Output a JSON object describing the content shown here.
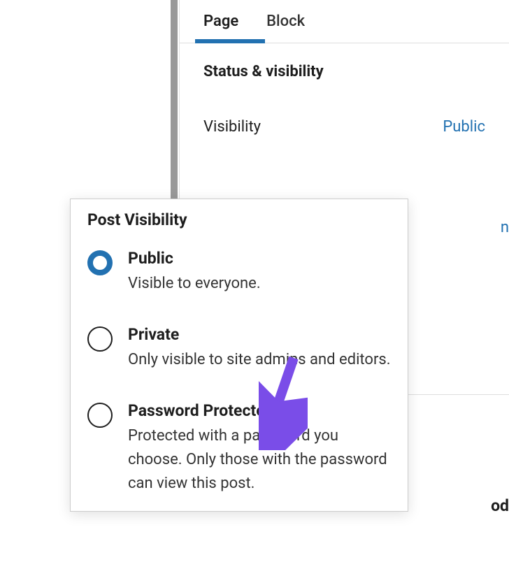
{
  "tabs": {
    "page": "Page",
    "block": "Block"
  },
  "panel": {
    "section_title": "Status & visibility",
    "visibility_label": "Visibility",
    "visibility_value": "Public"
  },
  "partial": {
    "link_fragment": "n",
    "text_fragment": "od"
  },
  "popover": {
    "title": "Post Visibility",
    "options": [
      {
        "label": "Public",
        "desc": "Visible to everyone.",
        "selected": true
      },
      {
        "label": "Private",
        "desc": "Only visible to site admins and editors.",
        "selected": false
      },
      {
        "label": "Password Protected",
        "desc": "Protected with a password you choose. Only those with the password can view this post.",
        "selected": false
      }
    ]
  }
}
